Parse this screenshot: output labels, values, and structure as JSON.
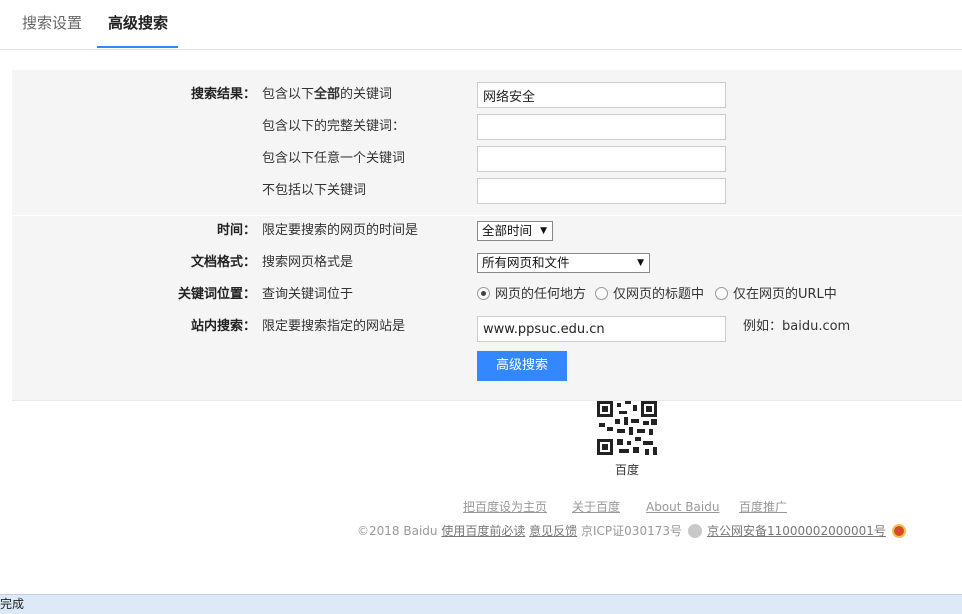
{
  "tabs": [
    {
      "label": "搜索设置"
    },
    {
      "label": "高级搜索"
    }
  ],
  "form": {
    "result": {
      "label": "搜索结果：",
      "rows": [
        {
          "desc_pre": "包含以下",
          "desc_strong": "全部",
          "desc_post": "的关键词",
          "value": "网络安全"
        },
        {
          "desc": "包含以下的完整关键词：",
          "value": ""
        },
        {
          "desc": "包含以下任意一个关键词",
          "value": ""
        },
        {
          "desc": "不包括以下关键词",
          "value": ""
        }
      ]
    },
    "time": {
      "label": "时间：",
      "desc": "限定要搜索的网页的时间是",
      "selected": "全部时间"
    },
    "format": {
      "label": "文档格式：",
      "desc": "搜索网页格式是",
      "selected": "所有网页和文件"
    },
    "position": {
      "label": "关键词位置：",
      "desc": "查询关键词位于",
      "options": [
        "网页的任何地方",
        "仅网页的标题中",
        "仅在网页的URL中"
      ],
      "selected_index": 0
    },
    "site": {
      "label": "站内搜索：",
      "desc": "限定要搜索指定的网站是",
      "value": "www.ppsuc.edu.cn",
      "example": "例如：baidu.com"
    },
    "submit": "高级搜索"
  },
  "footer": {
    "qr_label": "百度",
    "links": [
      "把百度设为主页",
      "关于百度",
      "About Baidu",
      "百度推广"
    ],
    "copyright": "©2018 Baidu",
    "terms": "使用百度前必读",
    "feedback": "意见反馈",
    "icp": "京ICP证030173号",
    "police": "京公网安备11000002000001号"
  },
  "status_bar": "完成",
  "colors": {
    "accent": "#3388ff",
    "panel_bg": "#f5f5f5",
    "status_bg": "#dde9f6"
  }
}
